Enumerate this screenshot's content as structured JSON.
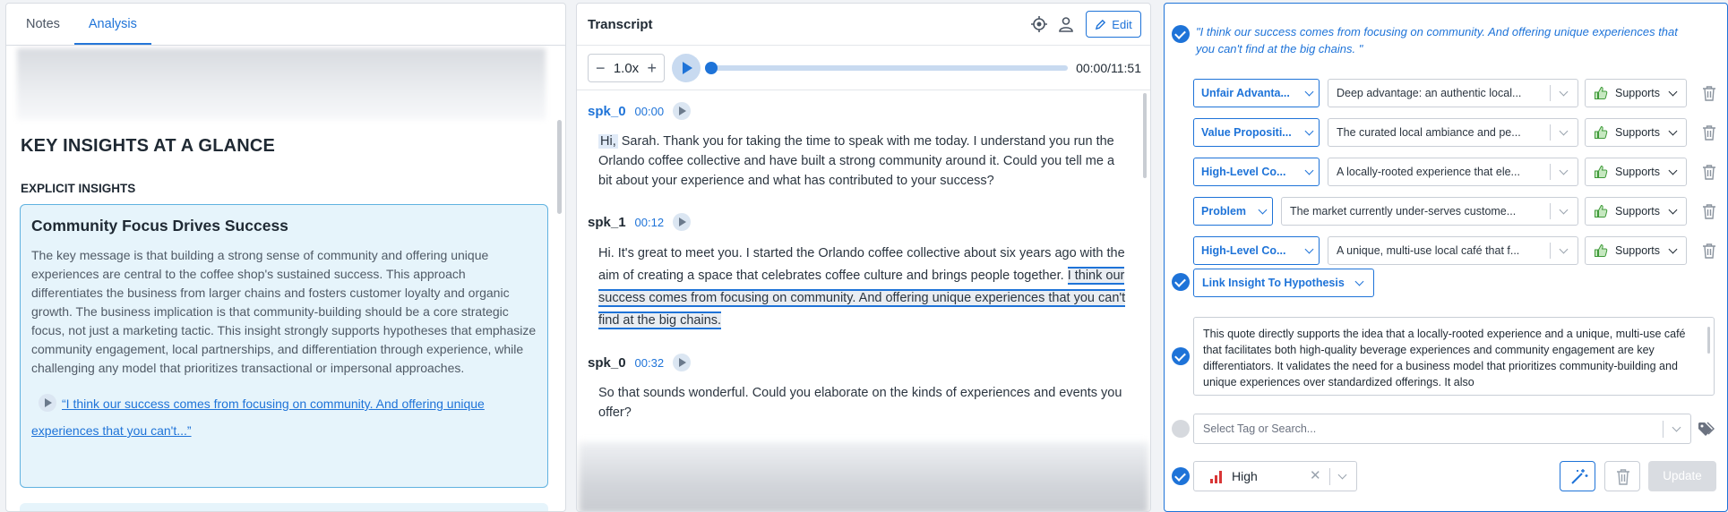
{
  "left": {
    "tabs": [
      {
        "label": "Notes"
      },
      {
        "label": "Analysis"
      }
    ],
    "insights_title": "KEY INSIGHTS AT A GLANCE",
    "explicit_label": "EXPLICIT INSIGHTS",
    "card": {
      "title": "Community Focus Drives Success",
      "body": "The key message is that building a strong sense of community and offering unique experiences are central to the coffee shop's sustained success. This approach differentiates the business from larger chains and fosters customer loyalty and organic growth. The business implication is that community-building should be a core strategic focus, not just a marketing tactic. This insight strongly supports hypotheses that emphasize community engagement, local partnerships, and differentiation through experience, while challenging any model that prioritizes transactional or impersonal approaches.",
      "quote": "“I think our success comes from focusing on community. And offering unique experiences that you can't...”"
    }
  },
  "transcript": {
    "title": "Transcript",
    "edit_label": "Edit",
    "speed": "1.0x",
    "time": "00:00/11:51",
    "progress": 0,
    "segments": [
      {
        "speaker": "spk_0",
        "timestamp": "00:00",
        "hi": "Hi,",
        "text": " Sarah. Thank you for taking the time to speak with me today. I understand you run the Orlando coffee collective and have built a strong community around it. Could you tell me a bit about your experience and what has contributed to your success?"
      },
      {
        "speaker": "spk_1",
        "timestamp": "00:12",
        "text": "Hi. It's great to meet you. I started the Orlando coffee collective about six years ago with the aim of creating a space that celebrates coffee culture and brings people together. ",
        "quote": "I think our success comes from focusing on community. And offering unique experiences that you can't find at the big chains."
      },
      {
        "speaker": "spk_0",
        "timestamp": "00:32",
        "text": "So that sounds wonderful. Could you elaborate on the kinds of experiences and events you offer?"
      }
    ]
  },
  "right": {
    "quote": "\"I think our success comes from focusing on community. And offering unique experiences that you can't find at the big chains. \"",
    "rows": [
      {
        "category": "Unfair Advanta...",
        "value": "Deep advantage: an authentic local...",
        "relation": "Supports"
      },
      {
        "category": "Value Propositi...",
        "value": "The curated local ambiance and pe...",
        "relation": "Supports"
      },
      {
        "category": "High-Level Co...",
        "value": "A locally-rooted experience that ele...",
        "relation": "Supports"
      },
      {
        "category": "Problem",
        "value": "The market currently under-serves custome...",
        "relation": "Supports"
      },
      {
        "category": "High-Level Co...",
        "value": "A unique, multi-use local café that f...",
        "relation": "Supports"
      }
    ],
    "link_label": "Link Insight To Hypothesis",
    "explanation": "This quote directly supports the idea that a locally-rooted experience and a unique, multi-use café that facilitates both high-quality beverage experiences and community engagement are key differentiators. It validates the need for a business model that prioritizes community-building and unique experiences over standardized offerings. It also",
    "tag_placeholder": "Select Tag or Search...",
    "priority": "High",
    "update_label": "Update"
  },
  "colors": {
    "accent": "#1e73d8",
    "card_bg": "#e6f4fb",
    "card_border": "#60b2e0",
    "thumb_green": "#4caf50",
    "priority_red": "#d93636"
  }
}
